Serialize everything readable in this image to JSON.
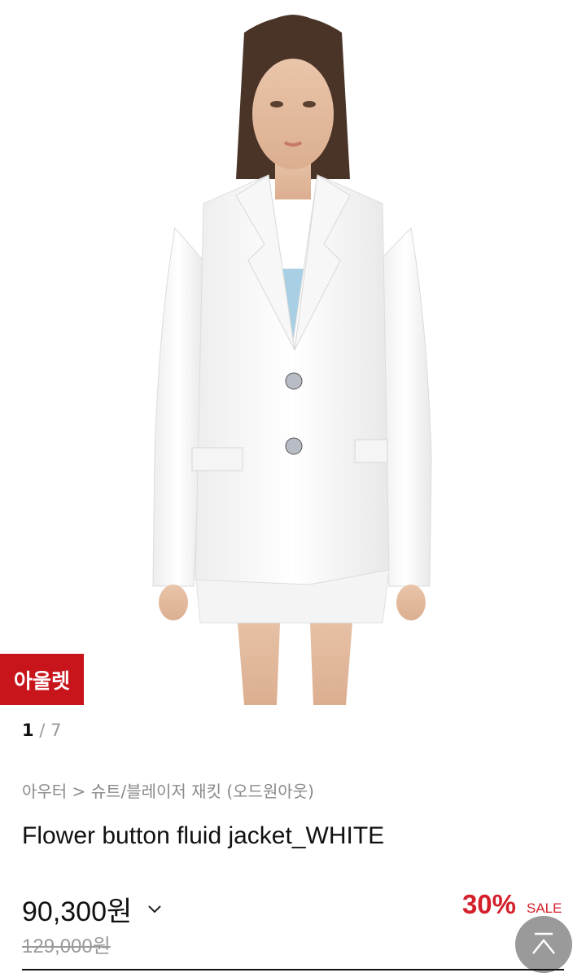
{
  "product": {
    "badge": "아울렛",
    "pager": {
      "current": "1",
      "separator": " / ",
      "total": "7"
    },
    "breadcrumb": {
      "category": "아우터",
      "separator": " > ",
      "subcategory": "슈트/블레이저 재킷",
      "brand": "(오드원아웃)"
    },
    "title": "Flower button fluid jacket_WHITE",
    "price": "90,300원",
    "original_price": "129,000원",
    "discount": "30%",
    "sale_label": "SALE"
  },
  "icons": {
    "price_toggle": "chevron-down-icon",
    "scroll_top": "arrow-up-icon"
  },
  "colors": {
    "badge_bg": "#c8151c",
    "discount": "#d4202a"
  }
}
